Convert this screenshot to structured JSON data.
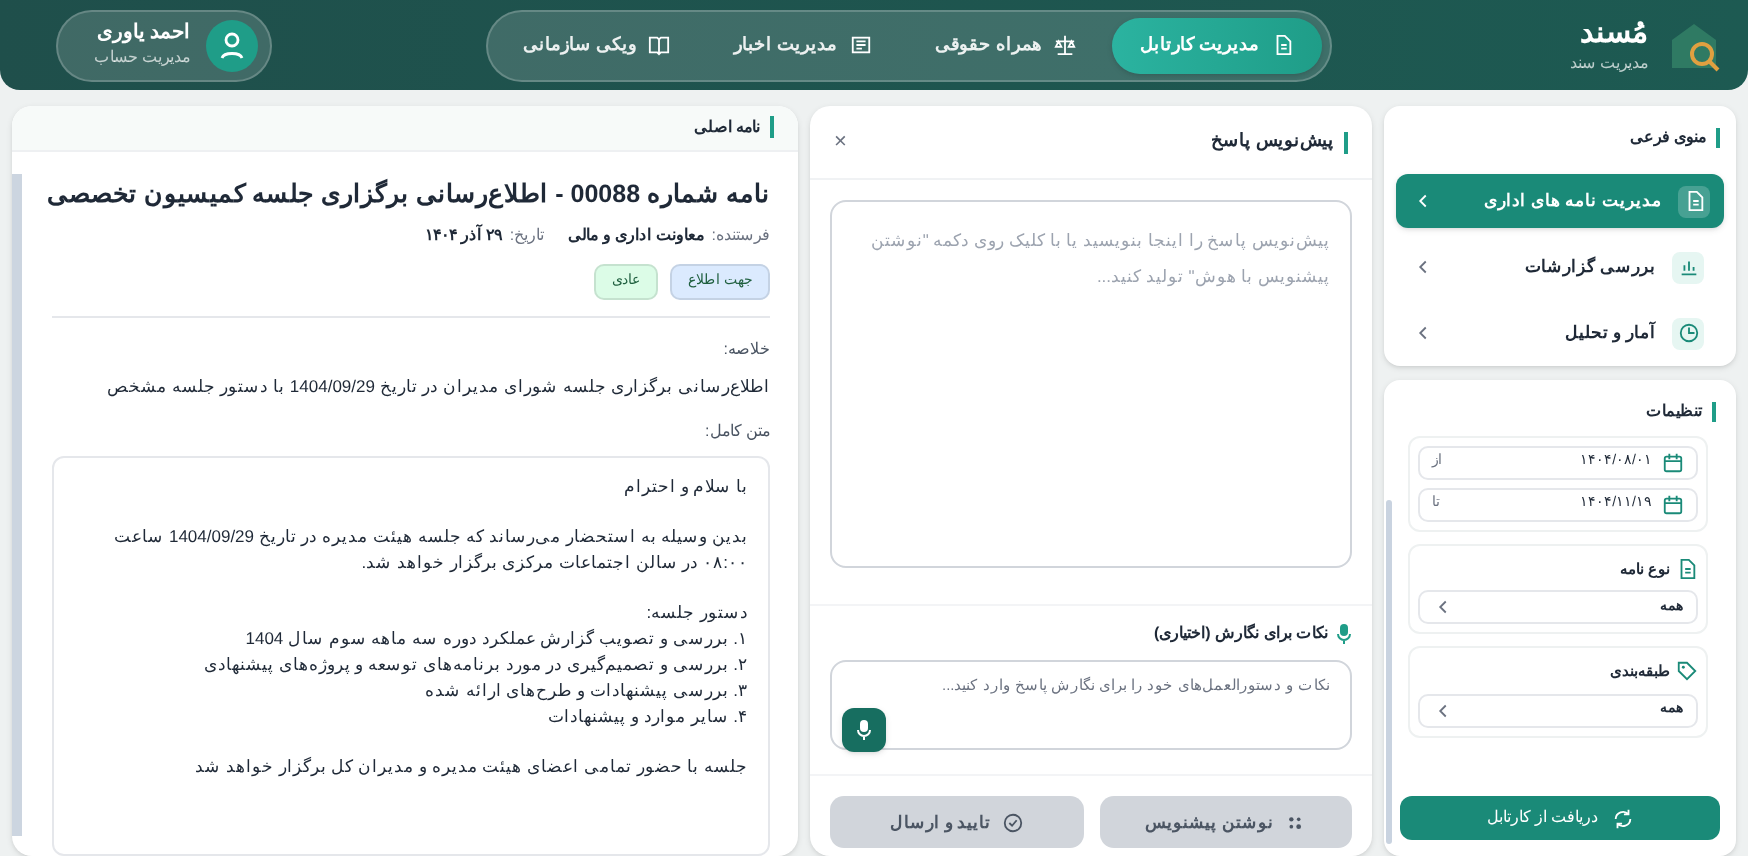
{
  "brand": {
    "title": "مُسند",
    "subtitle": "مدیریت سند"
  },
  "nav": [
    {
      "label": "مدیریت کارتابل",
      "selected": true
    },
    {
      "label": "همراه حقوقی",
      "selected": false
    },
    {
      "label": "مدیریت اخبار",
      "selected": false
    },
    {
      "label": "ویکی سازمانی",
      "selected": false
    }
  ],
  "account": {
    "name": "احمد یاوری",
    "role": "مدیریت حساب"
  },
  "sidebar": {
    "menu_title": "منوی فرعی",
    "items": [
      {
        "label": "مدیریت نامه های اداری",
        "selected": true
      },
      {
        "label": "بررسی گزارشات",
        "selected": false
      },
      {
        "label": "آمار و تحلیل",
        "selected": false
      }
    ],
    "settings_title": "تنظیمات",
    "dates": [
      {
        "value": "۱۴۰۴/۰۸/۰۱",
        "label": "از"
      },
      {
        "value": "۱۴۰۴/۱۱/۱۹",
        "label": "تا"
      }
    ],
    "filters": [
      {
        "label": "نوع نامه",
        "value": "همه"
      },
      {
        "label": "طبقه‌بندی",
        "value": "همه"
      }
    ],
    "fetch_button": "دریافت از کارتابل"
  },
  "draft": {
    "title": "پیش‌نویس پاسخ",
    "close": "×",
    "placeholder": "پیش‌نویس پاسخ را اینجا بنویسید یا با کلیک روی دکمه \"نوشتن پیشنویس با هوش\" تولید کنید...",
    "notes_label": "نکات برای نگارش (اختیاری)",
    "notes_placeholder": "نکات و دستورالعمل‌های خود را برای نگارش پاسخ وارد کنید...",
    "buttons": [
      {
        "label": "نوشتن پیشنویس",
        "disabled": true
      },
      {
        "label": "تایید و ارسال",
        "disabled": true
      }
    ]
  },
  "letter": {
    "panel_title": "نامه اصلی",
    "title": "نامه شماره 00088 - اطلاع‌رسانی برگزاری جلسه کمیسیون تخصصی",
    "sender_label": "فرستنده:",
    "sender": "معاونت اداری و مالی",
    "date_label": "تاریخ:",
    "date": "۲۹ آذر ۱۴۰۴",
    "tags": [
      {
        "label": "جهت اطلاع",
        "color": "#dbeafe"
      },
      {
        "label": "عادی",
        "color": "#dcfce7"
      }
    ],
    "summary_label": "خلاصه:",
    "summary": "اطلاع‌رسانی برگزاری جلسه شورای مدیران در تاریخ 1404/09/29 با دستور جلسه مشخص",
    "full_label": "متن کامل:",
    "body": [
      {
        "kind": "para",
        "text": "با سلام و احترام"
      },
      {
        "kind": "para",
        "text": "بدین وسیله به استحضار می‌رساند که جلسه هیئت مدیره در تاریخ 1404/09/29 ساعت ۰۸:۰۰ در سالن اجتماعات مرکزی برگزار خواهد شد."
      },
      {
        "kind": "list",
        "text": "دستور جلسه:",
        "items": [
          "۱. بررسی و تصویب گزارش عملکرد دوره سه ماهه سوم سال 1404",
          "۲. بررسی و تصمیم‌گیری در مورد برنامه‌های توسعه و پروژه‌های پیشنهادی",
          "۳. بررسی پیشنهادات و طرح‌های ارائه شده",
          "۴. سایر موارد و پیشنهادات"
        ]
      },
      {
        "kind": "para",
        "text": "جلسه با حضور تمامی اعضای هیئت مدیره و مدیران کل برگزار خواهد شد"
      }
    ]
  }
}
